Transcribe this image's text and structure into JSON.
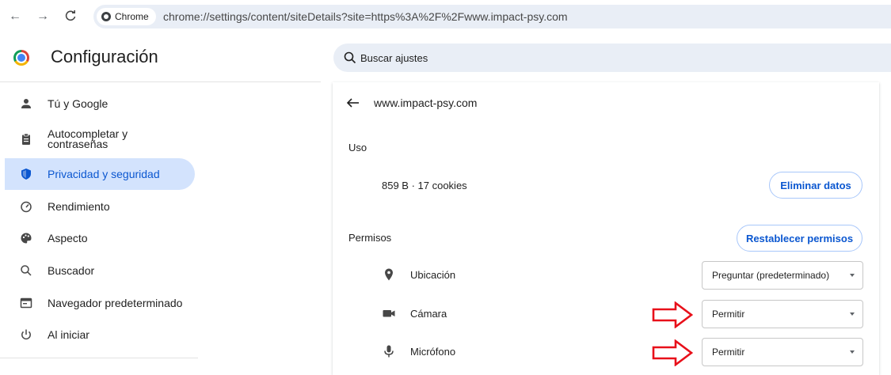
{
  "address_bar": {
    "chip_label": "Chrome",
    "url": "chrome://settings/content/siteDetails?site=https%3A%2F%2Fwww.impact-psy.com"
  },
  "header": {
    "title": "Configuración",
    "search_placeholder": "Buscar ajustes"
  },
  "sidebar": {
    "items": [
      {
        "label": "Tú y Google",
        "icon": "person-icon"
      },
      {
        "label": "Autocompletar y contraseñas",
        "icon": "clipboard-icon"
      },
      {
        "label": "Privacidad y seguridad",
        "icon": "shield-icon",
        "active": true
      },
      {
        "label": "Rendimiento",
        "icon": "speedometer-icon"
      },
      {
        "label": "Aspecto",
        "icon": "palette-icon"
      },
      {
        "label": "Buscador",
        "icon": "search-icon"
      },
      {
        "label": "Navegador predeterminado",
        "icon": "browser-window-icon"
      },
      {
        "label": "Al iniciar",
        "icon": "power-icon"
      }
    ]
  },
  "site": {
    "title": "www.impact-psy.com",
    "usage_label": "Uso",
    "usage_text": "859 B · 17 cookies",
    "delete_button": "Eliminar datos",
    "permissions_label": "Permisos",
    "reset_button": "Restablecer permisos",
    "permissions": [
      {
        "label": "Ubicación",
        "value": "Preguntar (predeterminado)",
        "icon": "location-pin-icon"
      },
      {
        "label": "Cámara",
        "value": "Permitir",
        "icon": "camera-icon"
      },
      {
        "label": "Micrófono",
        "value": "Permitir",
        "icon": "microphone-icon"
      }
    ]
  },
  "colors": {
    "accent": "#0b57d0",
    "active_bg": "#d3e3fd",
    "annotation_red": "#e8101a",
    "search_bg": "#e9eef6"
  }
}
